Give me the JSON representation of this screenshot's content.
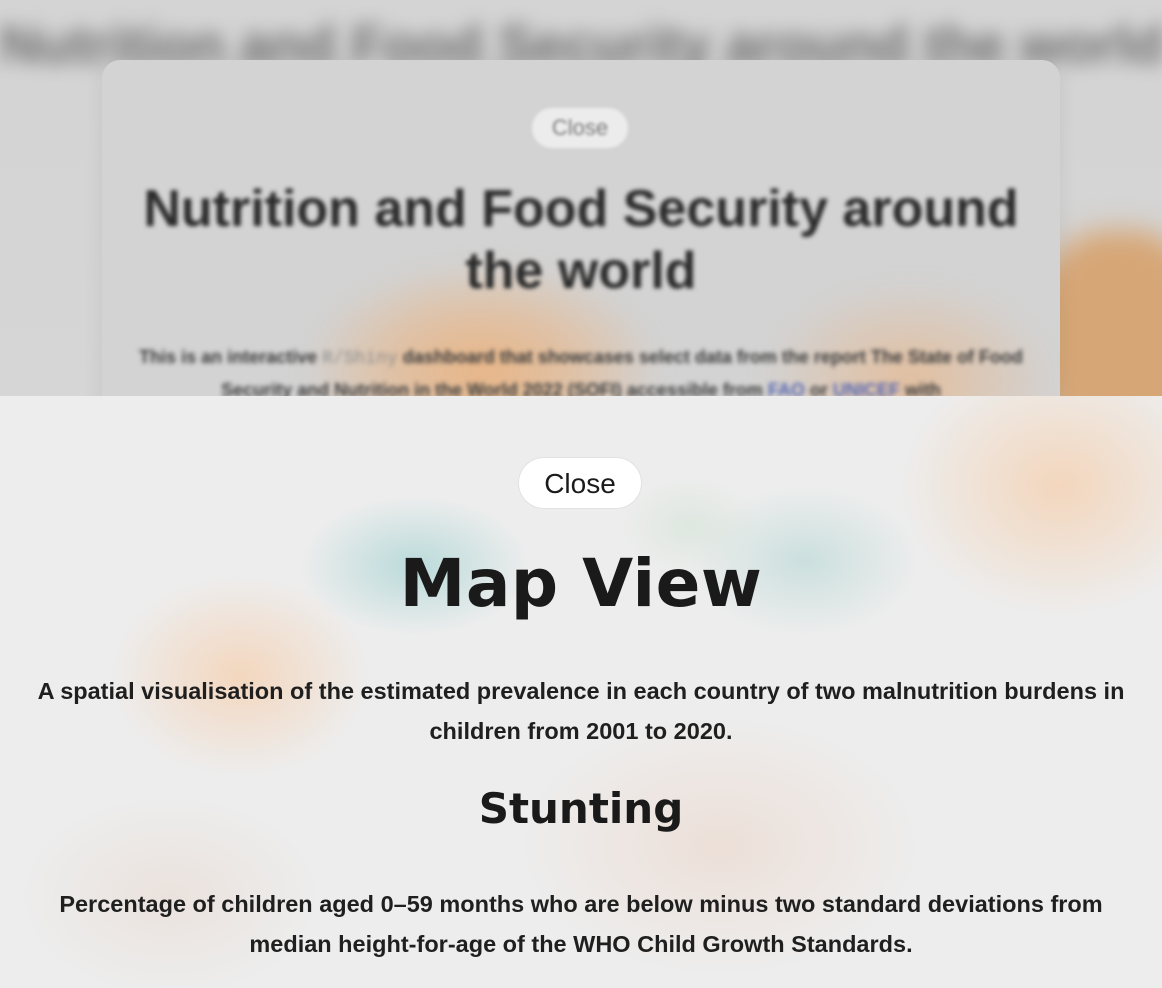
{
  "background": {
    "header_text": "Nutrition and Food Security around the world",
    "modal": {
      "close_label": "Close",
      "title": "Nutrition and Food Security around the world",
      "intro_before_code": "This is an interactive",
      "intro_code": "R/Shiny",
      "intro_after_code": "dashboard that showcases select data from the report The State of Food Security and Nutrition in the World 2022 (SOFI) accessible from",
      "link_fao": "FAO",
      "intro_or": "or",
      "link_unicef": "UNICEF",
      "intro_tail": "with"
    }
  },
  "modal": {
    "close_label": "Close",
    "title": "Map View",
    "description": "A spatial visualisation of the estimated prevalence in each country of two malnutrition burdens in children from 2001 to 2020.",
    "section_title": "Stunting",
    "section_description": "Percentage of children aged 0–59 months who are below minus two standard deviations from median height-for-age of the WHO Child Growth Standards."
  },
  "colors": {
    "overlay": "#d4d4d4",
    "modal_background": "#ededed",
    "text": "#1a1a1a",
    "link": "#5566b0",
    "accent_peach": "#e8b586",
    "accent_teal": "#aad4d4"
  }
}
